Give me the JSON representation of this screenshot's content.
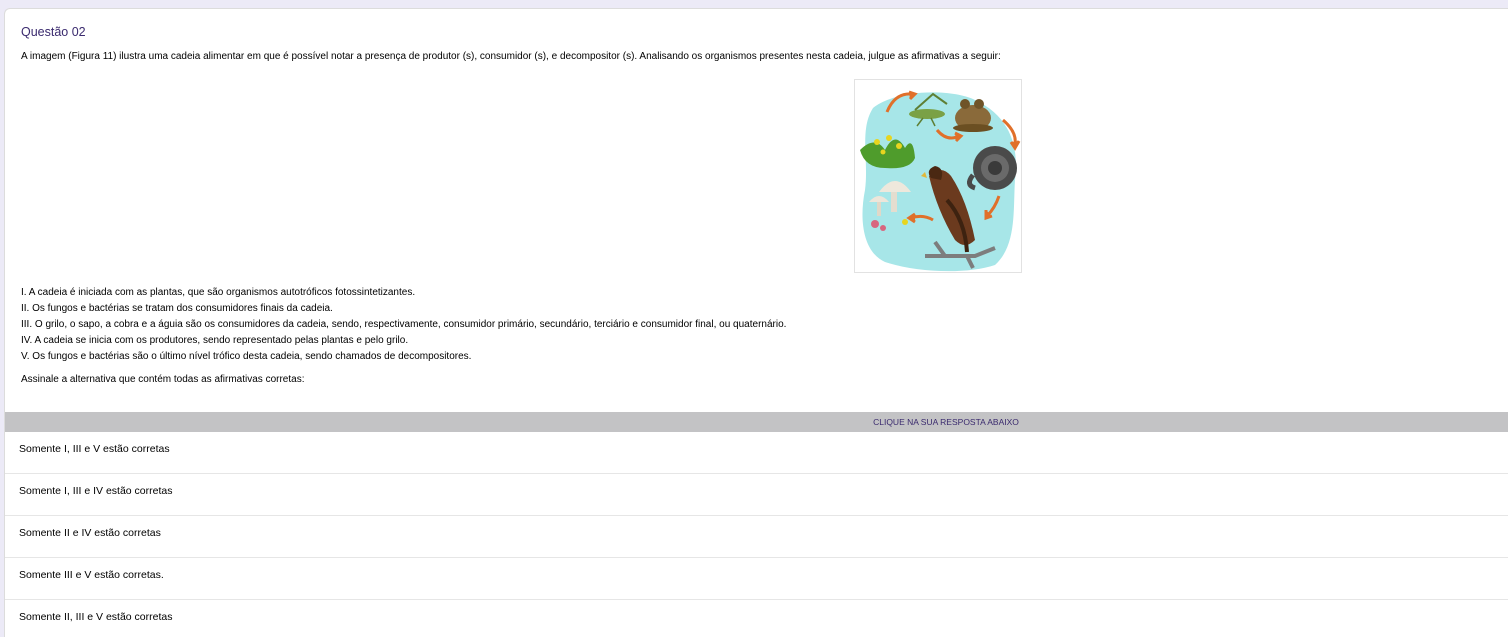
{
  "question": {
    "title": "Questão 02",
    "statement": "A imagem (Figura 11) ilustra uma cadeia alimentar em que é possível notar a presença de produtor (s), consumidor (s), e decompositor (s). Analisando os organismos presentes nesta cadeia, julgue as afirmativas a seguir:",
    "items": [
      "I. A cadeia é iniciada com as plantas, que são organismos autotróficos fotossintetizantes.",
      "II. Os fungos e bactérias se tratam dos consumidores finais da cadeia.",
      "III. O grilo, o sapo, a cobra e a águia são os consumidores da cadeia, sendo, respectivamente, consumidor primário, secundário, terciário e consumidor final, ou quaternário.",
      "IV. A cadeia se inicia com os produtores, sendo representado pelas plantas e pelo grilo.",
      "V. Os fungos e bactérias são o último nível trófico desta cadeia, sendo chamados de decompositores."
    ],
    "prompt": "Assinale a alternativa que contém todas as afirmativas corretas:"
  },
  "answer_bar": {
    "label": "CLIQUE NA SUA RESPOSTA ABAIXO"
  },
  "options": [
    "Somente I, III e V estão corretas",
    "Somente I, III e IV estão corretas",
    "Somente II e IV estão corretas",
    "Somente III e V estão corretas.",
    "Somente II, III e V estão corretas"
  ],
  "figure": {
    "icon": "food-chain-illustration",
    "colors": {
      "water": "#9fe3e6",
      "arrow": "#e0702a",
      "plant": "#4d9a2a",
      "eagle": "#6b3a1e"
    }
  }
}
